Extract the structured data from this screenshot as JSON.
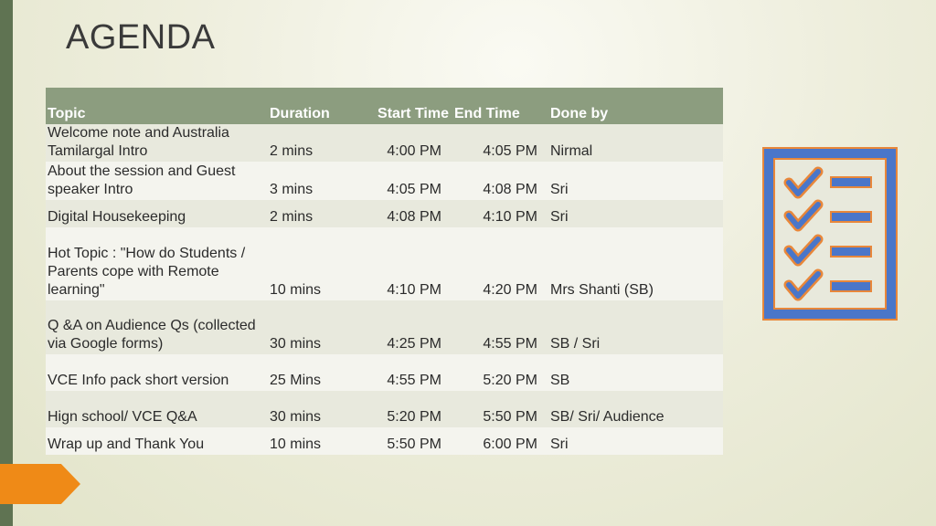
{
  "slide": {
    "title": "AGENDA"
  },
  "table": {
    "headers": {
      "topic": "Topic",
      "duration": "Duration",
      "start": "Start Time",
      "end": "End Time",
      "done_by": "Done by"
    },
    "rows": [
      {
        "topic": "Welcome note and Australia Tamilargal Intro",
        "duration": "2 mins",
        "start": "4:00 PM",
        "end": "4:05 PM",
        "done_by": "Nirmal"
      },
      {
        "topic": "About the session and Guest speaker Intro",
        "duration": "3 mins",
        "start": "4:05 PM",
        "end": "4:08 PM",
        "done_by": "Sri"
      },
      {
        "topic": "Digital Housekeeping",
        "duration": "2 mins",
        "start": "4:08 PM",
        "end": "4:10 PM",
        "done_by": "Sri"
      },
      {
        "topic": "Hot Topic : \"How do Students / Parents cope with Remote learning\"",
        "duration": "10 mins",
        "start": "4:10 PM",
        "end": "4:20 PM",
        "done_by": "Mrs Shanti (SB)"
      },
      {
        "topic": "Q &A on Audience Qs (collected via Google forms)",
        "duration": "30 mins",
        "start": "4:25 PM",
        "end": "4:55 PM",
        "done_by": "SB / Sri"
      },
      {
        "topic": "VCE Info pack short version",
        "duration": "25 Mins",
        "start": "4:55 PM",
        "end": "5:20 PM",
        "done_by": "SB"
      },
      {
        "topic": "Hign school/ VCE Q&A",
        "duration": "30 mins",
        "start": "5:20 PM",
        "end": "5:50 PM",
        "done_by": "SB/ Sri/ Audience"
      },
      {
        "topic": "Wrap up and Thank You",
        "duration": "10 mins",
        "start": "5:50 PM",
        "end": "6:00 PM",
        "done_by": "Sri"
      }
    ]
  },
  "decor": {
    "checklist_icon": "checklist-icon",
    "colors": {
      "header_bg": "#8c9d7f",
      "accent_orange": "#ef8a17",
      "left_bar": "#5f7352",
      "checklist_blue": "#4a76c9"
    }
  }
}
